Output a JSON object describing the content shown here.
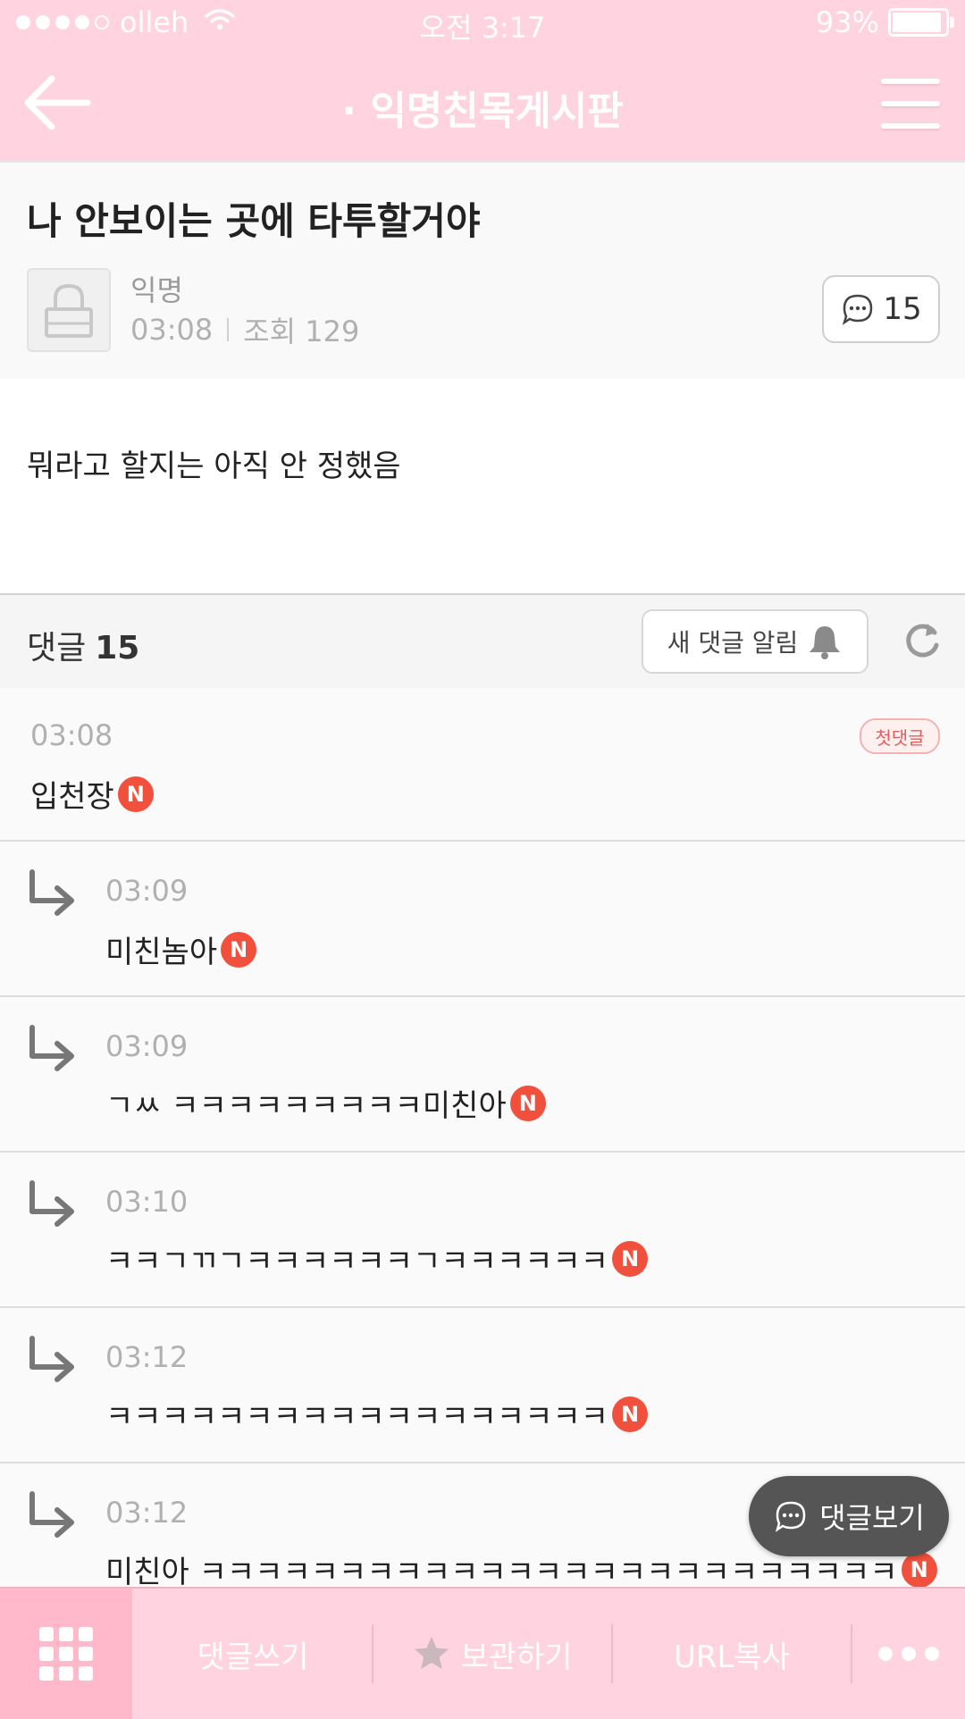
{
  "status_bar": {
    "carrier": "olleh",
    "time": "오전 3:17",
    "battery": "93%",
    "battery_level": 0.93
  },
  "header": {
    "title": "· 익명친목게시판"
  },
  "post": {
    "title": "나 안보이는 곳에 타투할거야",
    "author": "익명",
    "time": "03:08",
    "views_label": "조회 129",
    "comment_count": "15",
    "content": "뭐라고 할지는 아직 안 정했음"
  },
  "comments_bar": {
    "label": "댓글",
    "count": "15",
    "alert_label": "새 댓글 알림"
  },
  "comments": [
    {
      "time": "03:08",
      "text": "입천장",
      "badge": "N",
      "first_label": "첫댓글"
    },
    {
      "time": "03:09",
      "text": "미친놈아",
      "badge": "N"
    },
    {
      "time": "03:09",
      "text": "ㄱㅆ ㅋㅋㅋㅋㅋㅋㅋㅋㅋ미친아",
      "badge": "N"
    },
    {
      "time": "03:10",
      "text": "ㅋㅋㄱㄲㄱㅋㅋㅋㅋㅋㅋㄱㅋㅋㅋㅋㅋㅋ",
      "badge": "N"
    },
    {
      "time": "03:12",
      "text": "ㅋㅋㅋㅋㅋㅋㅋㅋㅋㅋㅋㅋㅋㅋㅋㅋㅋㅋ",
      "badge": "N"
    },
    {
      "time": "03:12",
      "text": "미친아 ㅋㅋㅋㅋㅋㅋㅋㅋㅋㅋㅋㅋㅋㅋㅋㅋㅋㅋㅋㅋㅋㅋㅋㅋㅋ",
      "badge": "N"
    }
  ],
  "fab": {
    "label": "댓글보기"
  },
  "bottom_bar": {
    "write_comment": "댓글쓰기",
    "save": "보관하기",
    "copy_url": "URL복사"
  },
  "colors": {
    "theme_pink": "#ffd3df",
    "badge_red": "#f0503c"
  }
}
